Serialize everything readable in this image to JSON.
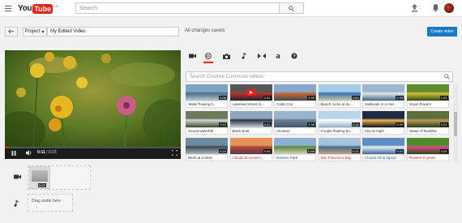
{
  "header": {
    "logo_you": "You",
    "logo_tube": "Tube",
    "logo_country": "CA",
    "search_placeholder": "Search"
  },
  "toolbar": {
    "project_label": "Project",
    "title_value": "My Edited Video",
    "status": "All changes saved.",
    "create_label": "Create video"
  },
  "player": {
    "time_current": "0:11",
    "time_total": "/ 0:23",
    "progress_fraction": 0.02
  },
  "tabs": {
    "active": "creative-commons",
    "items": [
      "video-camera-icon",
      "creative-commons-icon",
      "photo-camera-icon",
      "music-note-icon",
      "transitions-icon",
      "text-icon",
      "help-icon"
    ],
    "text_tab_letter": "a"
  },
  "library": {
    "search_placeholder": "Search Creative Commons videos",
    "videos": [
      {
        "title": "Water flowing fr...",
        "duration": "0:08",
        "scene": "water"
      },
      {
        "title": "Lakeland street (n...",
        "duration": "0:22",
        "scene": "street"
      },
      {
        "title": "Cable Car",
        "duration": "0:35",
        "scene": "cablecar"
      },
      {
        "title": "Beach rocks at du...",
        "duration": "2:53",
        "scene": "beach"
      },
      {
        "title": "Sailboats in a mar...",
        "duration": "0:35",
        "scene": "marina"
      },
      {
        "title": "Vision flowers",
        "duration": "1:02",
        "scene": "flowers"
      },
      {
        "title": "Sound waterfall",
        "duration": "0:42",
        "scene": "waterfall"
      },
      {
        "title": "Black boat",
        "duration": "0:41",
        "scene": "boat"
      },
      {
        "title": "Alcatraz",
        "duration": "0:38",
        "scene": "alcatraz"
      },
      {
        "title": "Couple floating bu...",
        "duration": "1:14",
        "scene": "sky"
      },
      {
        "title": "City at night",
        "duration": "0:30",
        "scene": "city"
      },
      {
        "title": "statue of Buddha",
        "duration": "0:24",
        "scene": "buddha"
      },
      {
        "title": "Birds at a dock",
        "duration": "0:24",
        "scene": "dock"
      },
      {
        "title": "Clouds at sunset (...",
        "duration": "0:46",
        "scene": "sunset"
      },
      {
        "title": "Dolores Park",
        "duration": "0:55",
        "scene": "park"
      },
      {
        "title": "San Francisco Bay...",
        "duration": "0:25",
        "scene": "bay"
      },
      {
        "title": "Clouds (time lapse)",
        "duration": "0:34",
        "scene": "clouds"
      },
      {
        "title": "Flowers in grass",
        "duration": "0:28",
        "scene": "grass"
      }
    ]
  },
  "timeline": {
    "clip_duration": "0:02",
    "audio_placeholder": "Drag audio here"
  },
  "colors": {
    "brand_red": "#e62117",
    "primary_blue": "#167ac6",
    "link_red": "#cc181e"
  }
}
